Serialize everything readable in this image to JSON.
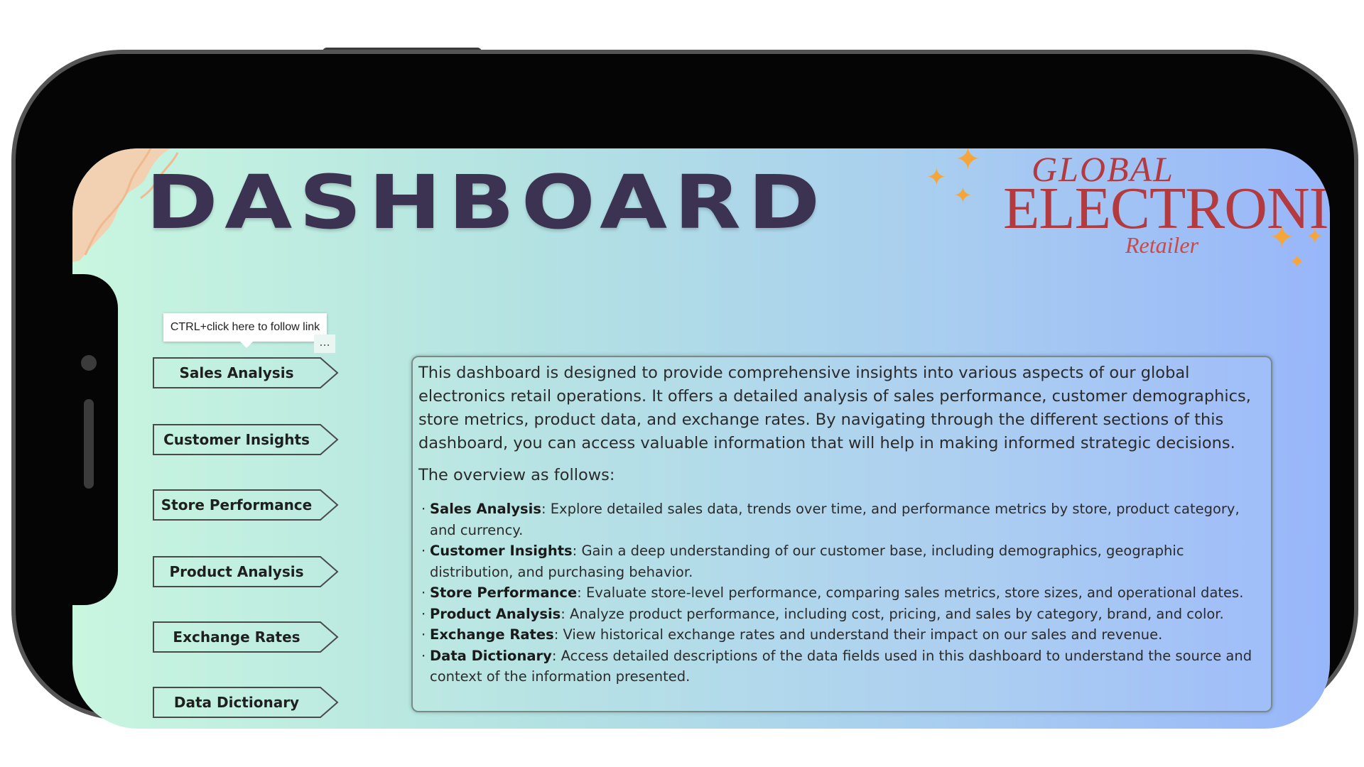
{
  "header": {
    "title": "DASHBOARD"
  },
  "logo": {
    "line1": "GLOBAL",
    "line2": "ELECTRONICS",
    "line3": "Retailer"
  },
  "tooltip": {
    "text": "CTRL+click here to follow link",
    "more": "..."
  },
  "nav": [
    {
      "label": "Sales Analysis"
    },
    {
      "label": "Customer Insights"
    },
    {
      "label": "Store Performance"
    },
    {
      "label": "Product Analysis"
    },
    {
      "label": "Exchange Rates"
    },
    {
      "label": "Data Dictionary"
    }
  ],
  "panel": {
    "intro": "This dashboard is designed to provide comprehensive insights into various aspects of our global electronics retail operations. It offers a detailed analysis of sales performance, customer demographics, store metrics, product data, and exchange rates. By navigating through the different sections of this dashboard, you can access valuable information that will help in making informed strategic decisions.",
    "overview": "The overview as follows:",
    "items": [
      {
        "term": "Sales Analysis",
        "desc": ": Explore detailed sales data, trends over time, and performance metrics by store, product category, and currency."
      },
      {
        "term": "Customer Insights",
        "desc": ": Gain a deep understanding of our customer base, including demographics, geographic distribution, and purchasing behavior."
      },
      {
        "term": "Store Performance",
        "desc": ": Evaluate store-level performance, comparing sales metrics, store sizes, and operational dates."
      },
      {
        "term": "Product Analysis",
        "desc": ": Analyze product performance, including cost, pricing, and sales by category, brand, and color."
      },
      {
        "term": "Exchange Rates",
        "desc": ": View historical exchange rates and understand their impact on our sales and revenue."
      },
      {
        "term": "Data Dictionary",
        "desc": ": Access detailed descriptions of the data fields used in this dashboard to understand the source and context of the information presented."
      }
    ]
  },
  "colors": {
    "title": "#3b3351",
    "logo": "#b33a3f",
    "sparkle": "#f5a63a",
    "gradient_start": "#c9f6df",
    "gradient_end": "#98b6fa"
  }
}
